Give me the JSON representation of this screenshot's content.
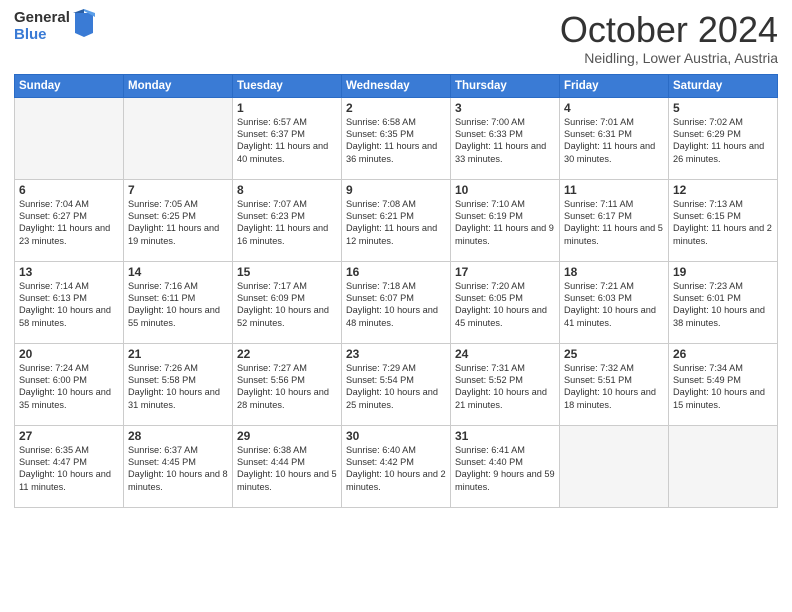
{
  "logo": {
    "general": "General",
    "blue": "Blue"
  },
  "title": "October 2024",
  "subtitle": "Neidling, Lower Austria, Austria",
  "days_of_week": [
    "Sunday",
    "Monday",
    "Tuesday",
    "Wednesday",
    "Thursday",
    "Friday",
    "Saturday"
  ],
  "weeks": [
    [
      {
        "day": "",
        "info": ""
      },
      {
        "day": "",
        "info": ""
      },
      {
        "day": "1",
        "info": "Sunrise: 6:57 AM\nSunset: 6:37 PM\nDaylight: 11 hours and 40 minutes."
      },
      {
        "day": "2",
        "info": "Sunrise: 6:58 AM\nSunset: 6:35 PM\nDaylight: 11 hours and 36 minutes."
      },
      {
        "day": "3",
        "info": "Sunrise: 7:00 AM\nSunset: 6:33 PM\nDaylight: 11 hours and 33 minutes."
      },
      {
        "day": "4",
        "info": "Sunrise: 7:01 AM\nSunset: 6:31 PM\nDaylight: 11 hours and 30 minutes."
      },
      {
        "day": "5",
        "info": "Sunrise: 7:02 AM\nSunset: 6:29 PM\nDaylight: 11 hours and 26 minutes."
      }
    ],
    [
      {
        "day": "6",
        "info": "Sunrise: 7:04 AM\nSunset: 6:27 PM\nDaylight: 11 hours and 23 minutes."
      },
      {
        "day": "7",
        "info": "Sunrise: 7:05 AM\nSunset: 6:25 PM\nDaylight: 11 hours and 19 minutes."
      },
      {
        "day": "8",
        "info": "Sunrise: 7:07 AM\nSunset: 6:23 PM\nDaylight: 11 hours and 16 minutes."
      },
      {
        "day": "9",
        "info": "Sunrise: 7:08 AM\nSunset: 6:21 PM\nDaylight: 11 hours and 12 minutes."
      },
      {
        "day": "10",
        "info": "Sunrise: 7:10 AM\nSunset: 6:19 PM\nDaylight: 11 hours and 9 minutes."
      },
      {
        "day": "11",
        "info": "Sunrise: 7:11 AM\nSunset: 6:17 PM\nDaylight: 11 hours and 5 minutes."
      },
      {
        "day": "12",
        "info": "Sunrise: 7:13 AM\nSunset: 6:15 PM\nDaylight: 11 hours and 2 minutes."
      }
    ],
    [
      {
        "day": "13",
        "info": "Sunrise: 7:14 AM\nSunset: 6:13 PM\nDaylight: 10 hours and 58 minutes."
      },
      {
        "day": "14",
        "info": "Sunrise: 7:16 AM\nSunset: 6:11 PM\nDaylight: 10 hours and 55 minutes."
      },
      {
        "day": "15",
        "info": "Sunrise: 7:17 AM\nSunset: 6:09 PM\nDaylight: 10 hours and 52 minutes."
      },
      {
        "day": "16",
        "info": "Sunrise: 7:18 AM\nSunset: 6:07 PM\nDaylight: 10 hours and 48 minutes."
      },
      {
        "day": "17",
        "info": "Sunrise: 7:20 AM\nSunset: 6:05 PM\nDaylight: 10 hours and 45 minutes."
      },
      {
        "day": "18",
        "info": "Sunrise: 7:21 AM\nSunset: 6:03 PM\nDaylight: 10 hours and 41 minutes."
      },
      {
        "day": "19",
        "info": "Sunrise: 7:23 AM\nSunset: 6:01 PM\nDaylight: 10 hours and 38 minutes."
      }
    ],
    [
      {
        "day": "20",
        "info": "Sunrise: 7:24 AM\nSunset: 6:00 PM\nDaylight: 10 hours and 35 minutes."
      },
      {
        "day": "21",
        "info": "Sunrise: 7:26 AM\nSunset: 5:58 PM\nDaylight: 10 hours and 31 minutes."
      },
      {
        "day": "22",
        "info": "Sunrise: 7:27 AM\nSunset: 5:56 PM\nDaylight: 10 hours and 28 minutes."
      },
      {
        "day": "23",
        "info": "Sunrise: 7:29 AM\nSunset: 5:54 PM\nDaylight: 10 hours and 25 minutes."
      },
      {
        "day": "24",
        "info": "Sunrise: 7:31 AM\nSunset: 5:52 PM\nDaylight: 10 hours and 21 minutes."
      },
      {
        "day": "25",
        "info": "Sunrise: 7:32 AM\nSunset: 5:51 PM\nDaylight: 10 hours and 18 minutes."
      },
      {
        "day": "26",
        "info": "Sunrise: 7:34 AM\nSunset: 5:49 PM\nDaylight: 10 hours and 15 minutes."
      }
    ],
    [
      {
        "day": "27",
        "info": "Sunrise: 6:35 AM\nSunset: 4:47 PM\nDaylight: 10 hours and 11 minutes."
      },
      {
        "day": "28",
        "info": "Sunrise: 6:37 AM\nSunset: 4:45 PM\nDaylight: 10 hours and 8 minutes."
      },
      {
        "day": "29",
        "info": "Sunrise: 6:38 AM\nSunset: 4:44 PM\nDaylight: 10 hours and 5 minutes."
      },
      {
        "day": "30",
        "info": "Sunrise: 6:40 AM\nSunset: 4:42 PM\nDaylight: 10 hours and 2 minutes."
      },
      {
        "day": "31",
        "info": "Sunrise: 6:41 AM\nSunset: 4:40 PM\nDaylight: 9 hours and 59 minutes."
      },
      {
        "day": "",
        "info": ""
      },
      {
        "day": "",
        "info": ""
      }
    ]
  ]
}
